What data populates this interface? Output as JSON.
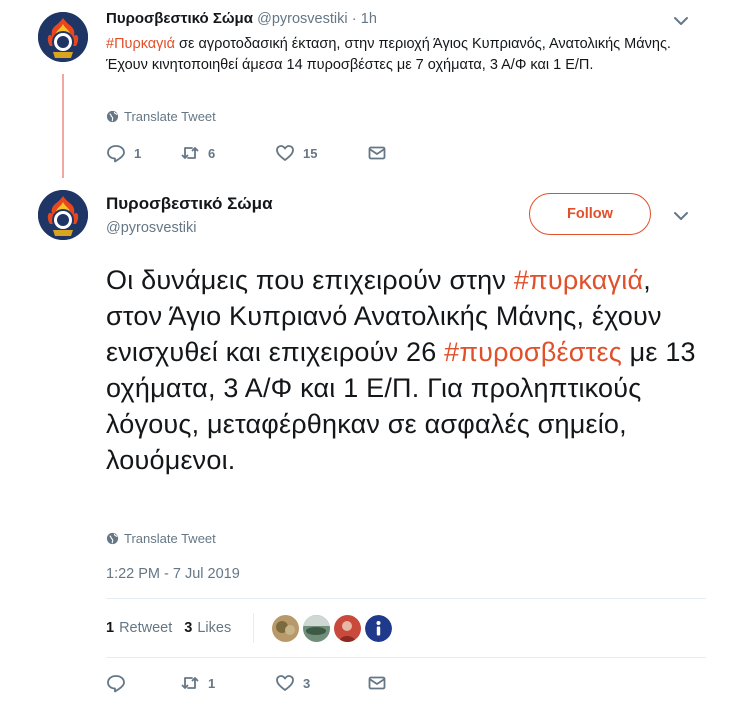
{
  "tweet1": {
    "display_name": "Πυροσβεστικό Σώμα",
    "handle": "@pyrosvestiki",
    "separator": "·",
    "time": "1h",
    "hashtag": "#Πυρκαγιά",
    "text_after_hashtag": " σε αγροτοδασική έκταση, στην περιοχή Άγιος Κυπριανός, Ανατολικής Μάνης. Έχουν κινητοποιηθεί άμεσα 14 πυροσβέστες με 7 οχήματα, 3 Α/Φ και 1 Ε/Π.",
    "translate_label": "Translate Tweet",
    "replies": "1",
    "retweets": "6",
    "likes": "15"
  },
  "tweet2": {
    "display_name": "Πυροσβεστικό Σώμα",
    "handle": "@pyrosvestiki",
    "follow_label": "Follow",
    "text_part1": "Οι δυνάμεις που επιχειρούν στην ",
    "hashtag1": "#πυρκαγιά",
    "text_part2": ", στον Άγιο Κυπριανό Ανατολικής Μάνης, έχουν ενισχυθεί και επιχειρούν 26 ",
    "hashtag2": "#πυροσβέστες",
    "text_part3": " με 13 οχήματα, 3 Α/Φ και 1 Ε/Π. Για προληπτικούς λόγους, μεταφέρθηκαν σε ασφαλές σημείο, λουόμενοι.",
    "translate_label": "Translate Tweet",
    "timestamp": "1:22 PM - 7 Jul 2019",
    "retweet_count": "1",
    "retweet_label": "Retweet",
    "like_count": "3",
    "like_label": "Likes",
    "replies": "",
    "retweets": "1",
    "likes": "3"
  },
  "colors": {
    "accent": "#e0502a",
    "muted": "#657786",
    "text": "#14171a",
    "thread_line": "#f3a7a0",
    "divider": "#e6ecf0"
  },
  "icons": [
    "avatar-emblem",
    "chevron-down-icon",
    "globe-icon",
    "reply-icon",
    "retweet-icon",
    "like-icon",
    "dm-icon",
    "info-icon"
  ]
}
